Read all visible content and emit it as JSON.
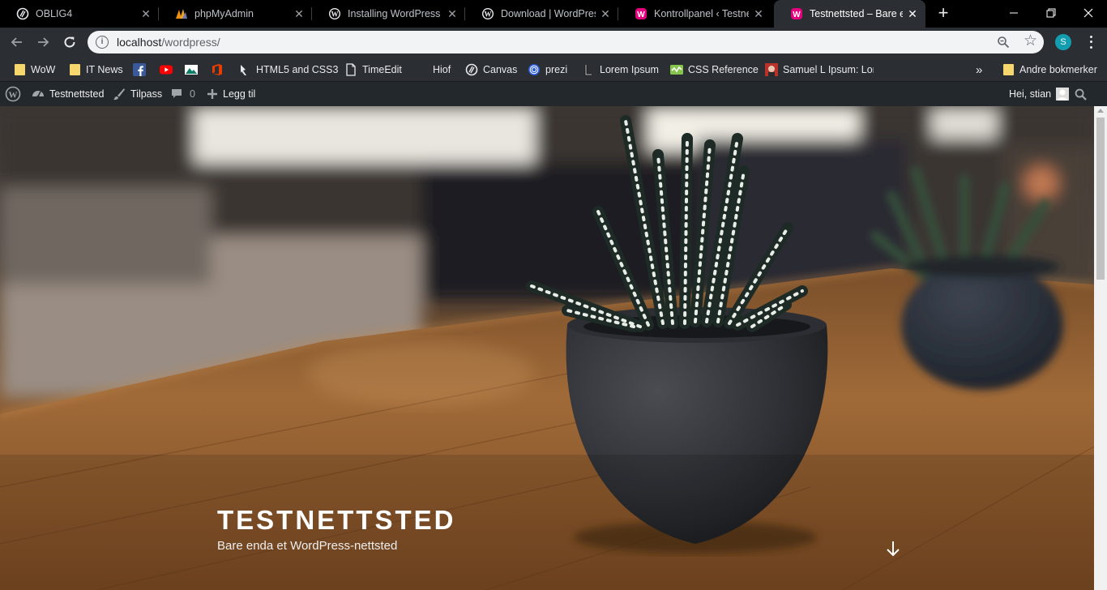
{
  "browser": {
    "tabs": [
      {
        "title": "OBLIG4",
        "icon": "canvas-logo-icon",
        "active": false
      },
      {
        "title": "phpMyAdmin",
        "icon": "phpmyadmin-logo-icon",
        "active": false
      },
      {
        "title": "Installing WordPress « W",
        "icon": "wordpress-logo-icon",
        "active": false
      },
      {
        "title": "Download | WordPress.o",
        "icon": "wordpress-logo-icon",
        "active": false
      },
      {
        "title": "Kontrollpanel ‹ Testnett",
        "icon": "wamp-logo-icon",
        "active": false
      },
      {
        "title": "Testnettsted – Bare enda",
        "icon": "wamp-logo-icon",
        "active": true
      }
    ],
    "close_glyph": "✕",
    "new_tab_glyph": "+",
    "address": {
      "host": "localhost",
      "path": "/wordpress/"
    },
    "profile_initial": "S",
    "accent_color": "#129eaf",
    "bookmarks": [
      {
        "label": "WoW",
        "icon": "folder-icon"
      },
      {
        "label": "IT News",
        "icon": "folder-icon"
      },
      {
        "label": "",
        "icon": "facebook-icon"
      },
      {
        "label": "",
        "icon": "youtube-icon"
      },
      {
        "label": "",
        "icon": "photo-icon"
      },
      {
        "label": "",
        "icon": "office-icon"
      },
      {
        "label": "HTML5 and CSS3",
        "icon": "bookmark-icon"
      },
      {
        "label": "TimeEdit",
        "icon": "page-icon"
      },
      {
        "label": "Hiof",
        "icon": "hiof-icon"
      },
      {
        "label": "Canvas",
        "icon": "canvas-logo-icon"
      },
      {
        "label": "prezi",
        "icon": "prezi-icon"
      },
      {
        "label": "Lorem Ipsum",
        "icon": "lorem-ipsum-icon"
      },
      {
        "label": "CSS Reference",
        "icon": "css-reference-icon"
      },
      {
        "label": "Samuel L Ipsum: Lore",
        "icon": "samuel-l-ipsum-icon"
      }
    ],
    "more_bookmarks_glyph": "»",
    "other_bookmarks_label": "Andre bokmerker"
  },
  "wp_admin_bar": {
    "site_name": "Testnettsted",
    "customize_label": "Tilpass",
    "comments_count": "0",
    "new_label": "Legg til",
    "greeting": "Hei, stian"
  },
  "hero": {
    "site_title": "TESTNETTSTED",
    "tagline": "Bare enda et WordPress-nettsted"
  }
}
